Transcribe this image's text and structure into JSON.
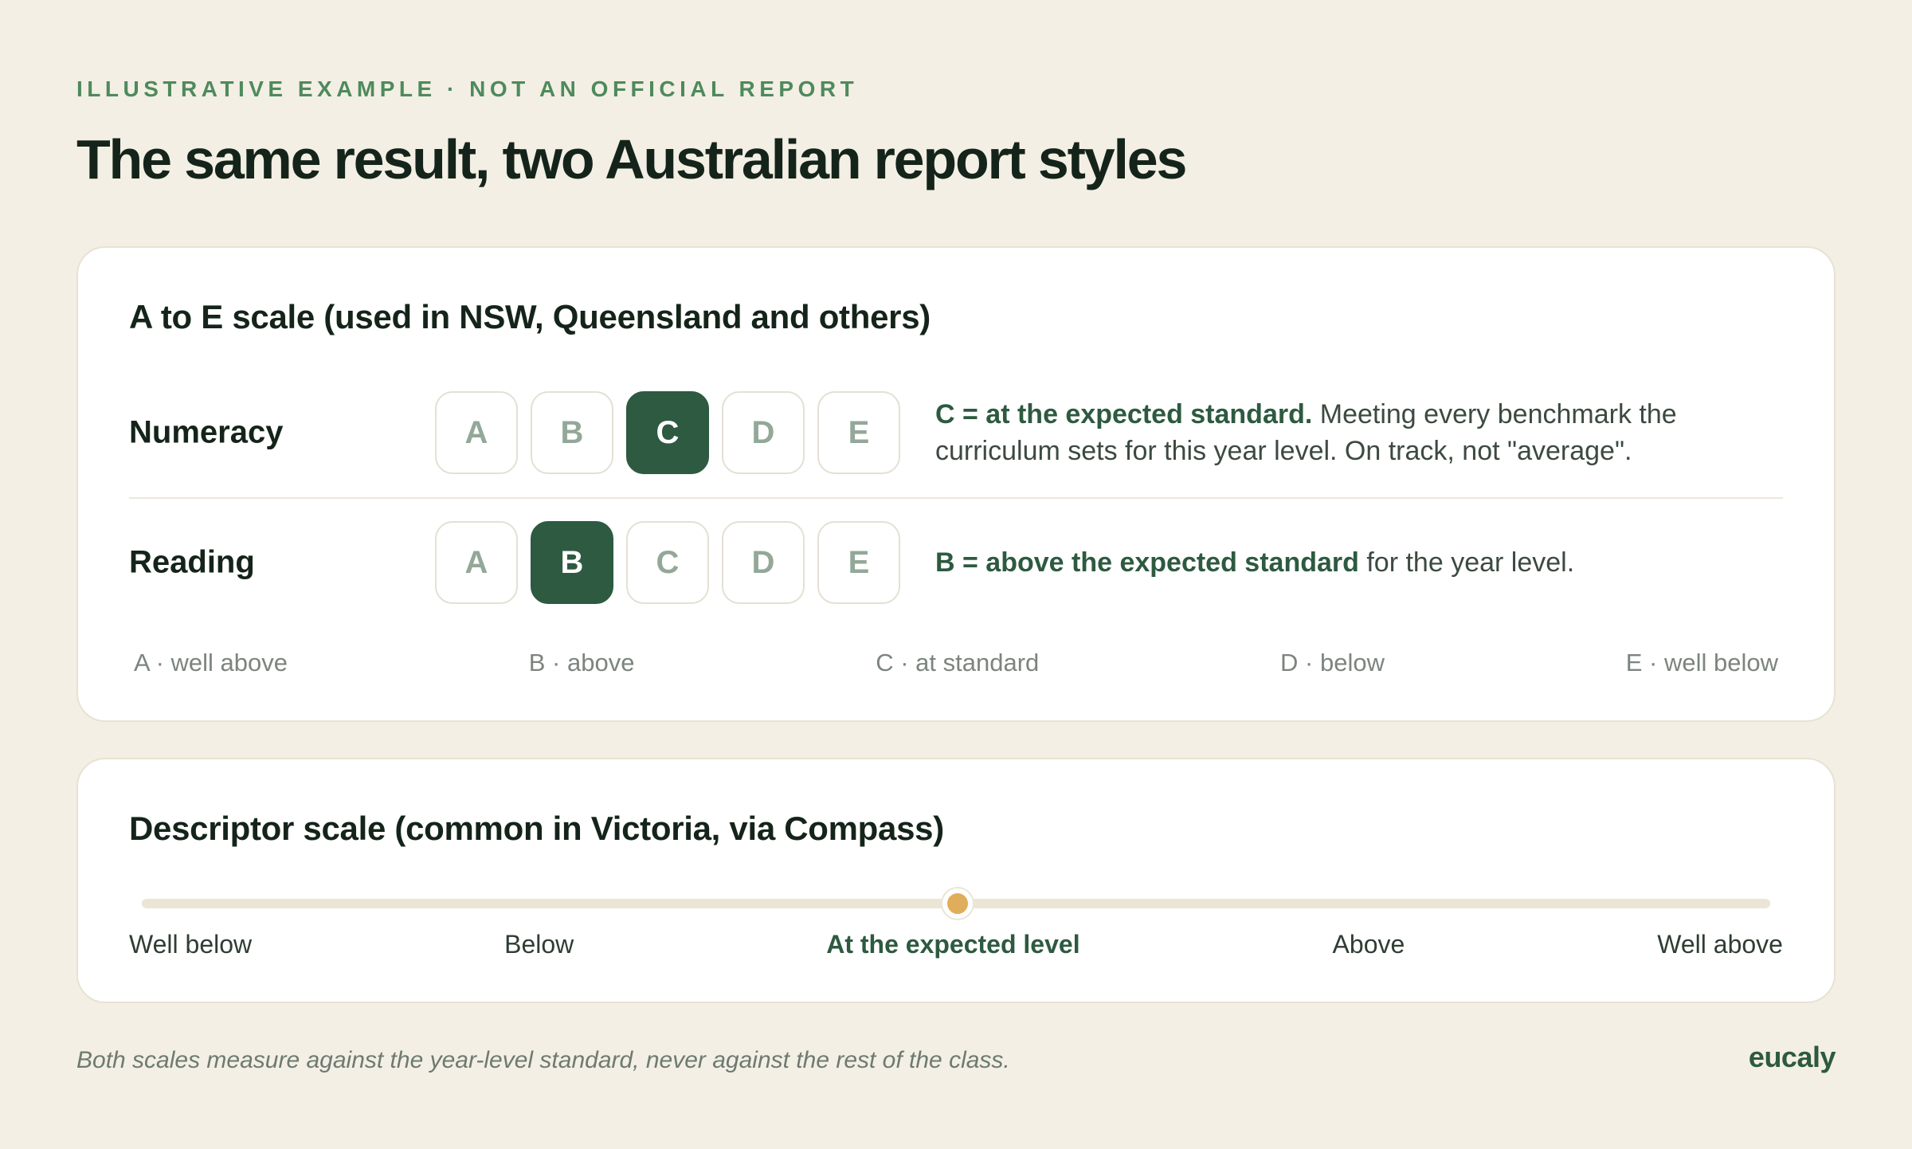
{
  "eyebrow": "ILLUSTRATIVE EXAMPLE · NOT AN OFFICIAL REPORT",
  "title": "The same result, two Australian report styles",
  "ae_card": {
    "title": "A to E scale (used in NSW, Queensland and others)",
    "grades": [
      "A",
      "B",
      "C",
      "D",
      "E"
    ],
    "rows": [
      {
        "label": "Numeracy",
        "selected": "C",
        "desc_strong": "C = at the expected standard.",
        "desc_rest": " Meeting every benchmark the curriculum sets for this year level. On track, not \"average\"."
      },
      {
        "label": "Reading",
        "selected": "B",
        "desc_strong": "B = above the expected standard",
        "desc_rest": " for the year level."
      }
    ],
    "key": [
      "A · well above",
      "B · above",
      "C · at standard",
      "D · below",
      "E · well below"
    ]
  },
  "desc_card": {
    "title": "Descriptor scale (common in Victoria, via Compass)",
    "levels": [
      "Well below",
      "Below",
      "At the expected level",
      "Above",
      "Well above"
    ],
    "current_level": "At the expected level",
    "current_index": 2
  },
  "footnote": "Both scales measure against the year-level standard, never against the rest of the class.",
  "brand": "eucaly",
  "colors": {
    "background": "#f3efe4",
    "accent_green": "#2d5a40",
    "eyebrow_green": "#4e8a5c",
    "marker_gold": "#e0ae5a"
  }
}
